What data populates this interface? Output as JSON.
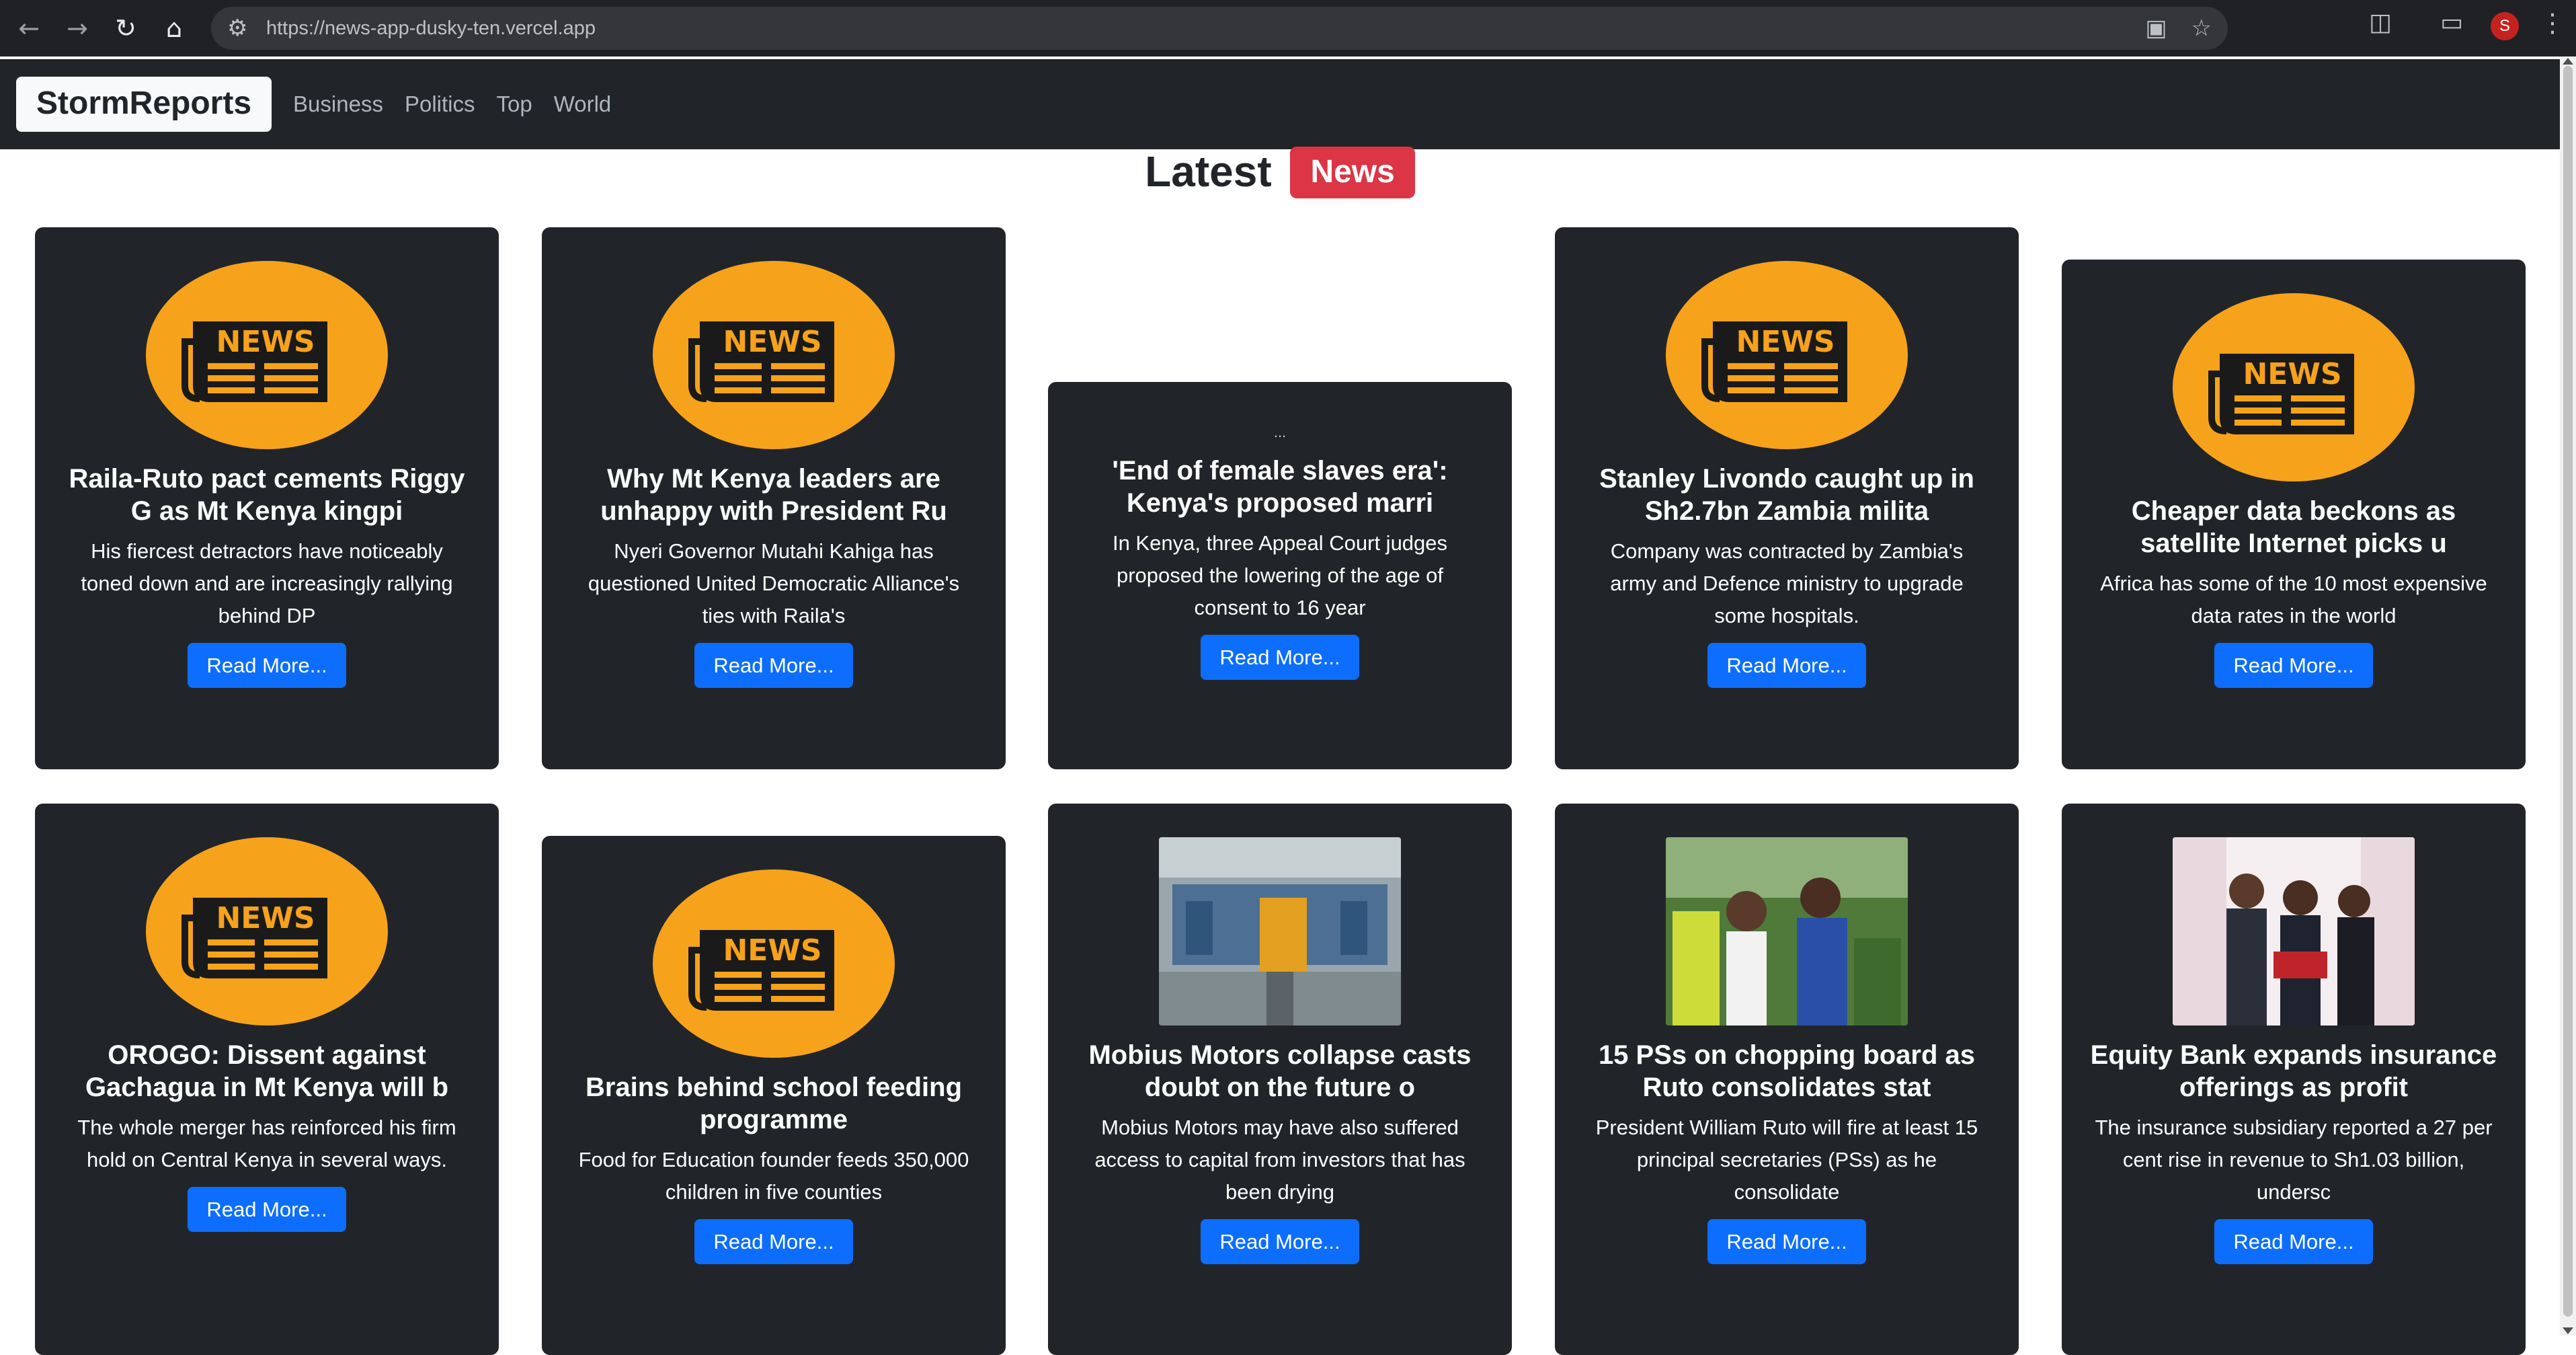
{
  "browser": {
    "url": "https://news-app-dusky-ten.vercel.app",
    "profile_initial": "S"
  },
  "navbar": {
    "brand": "StormReports",
    "links": [
      "Business",
      "Politics",
      "Top",
      "World"
    ]
  },
  "heading": {
    "text": "Latest",
    "badge": "News"
  },
  "news_logo_text": "NEWS",
  "broken_image_alt": "...",
  "cards": [
    {
      "image": "news-logo",
      "title": "Raila-Ruto pact cements Riggy G as Mt Kenya kingpi",
      "description": "His fiercest detractors have noticeably toned down and are increasingly rallying behind DP",
      "button": "Read More..."
    },
    {
      "image": "news-logo",
      "title": "Why Mt Kenya leaders are unhappy with President Ru",
      "description": "Nyeri Governor Mutahi Kahiga has questioned United Democratic Alliance's ties with Raila's",
      "button": "Read More..."
    },
    {
      "image": "broken",
      "title": "'End of female slaves era': Kenya's proposed marri",
      "description": "In Kenya, three Appeal Court judges proposed the lowering of the age of consent to 16 year",
      "button": "Read More..."
    },
    {
      "image": "news-logo",
      "title": "Stanley Livondo caught up in Sh2.7bn Zambia milita",
      "description": "Company was contracted by Zambia's army and Defence ministry to upgrade some hospitals.",
      "button": "Read More..."
    },
    {
      "image": "news-logo",
      "title": "Cheaper data beckons as satellite Internet picks u",
      "description": "Africa has some of the 10 most expensive data rates in the world",
      "button": "Read More..."
    },
    {
      "image": "news-logo",
      "title": "OROGO: Dissent against Gachagua in Mt Kenya will b",
      "description": "The whole merger has reinforced his firm hold on Central Kenya in several ways.",
      "button": "Read More..."
    },
    {
      "image": "news-logo",
      "title": "Brains behind school feeding programme",
      "description": "Food for Education founder feeds 350,000 children in five counties",
      "button": "Read More..."
    },
    {
      "image": "photo-factory",
      "title": "Mobius Motors collapse casts doubt on the future o",
      "description": "Mobius Motors may have also suffered access to capital from investors that has been drying",
      "button": "Read More..."
    },
    {
      "image": "photo-ruto",
      "title": "15 PSs on chopping board as Ruto consolidates stat",
      "description": "President William Ruto will fire at least 15 principal secretaries (PSs) as he consolidate",
      "button": "Read More..."
    },
    {
      "image": "photo-equity",
      "title": "Equity Bank expands insurance offerings as profit",
      "description": "The insurance subsidiary reported a 27 per cent rise in revenue to Sh1.03 billion, undersc",
      "button": "Read More..."
    }
  ]
}
